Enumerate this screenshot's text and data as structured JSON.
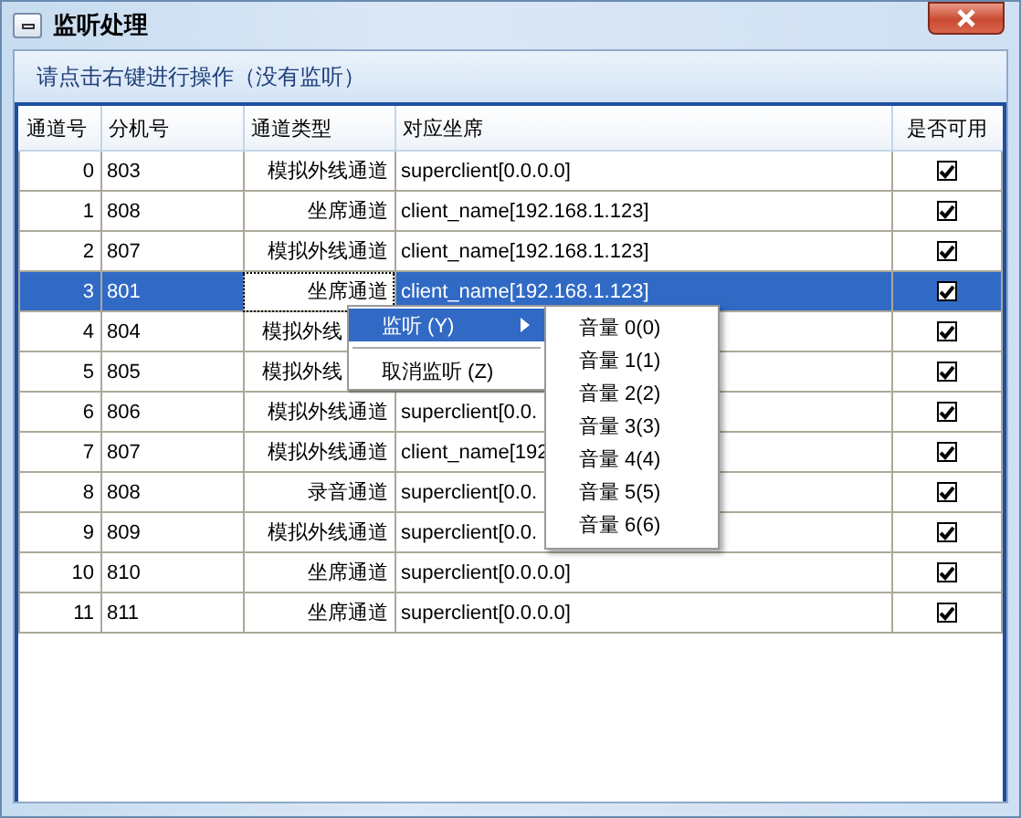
{
  "window": {
    "title": "监听处理"
  },
  "hint": "请点击右键进行操作（没有监听）",
  "table": {
    "columns": [
      "通道号",
      "分机号",
      "通道类型",
      "对应坐席",
      "是否可用"
    ],
    "rows": [
      {
        "channel": "0",
        "extension": "803",
        "type": "模拟外线通道",
        "seat": "superclient[0.0.0.0]",
        "enabled": true,
        "selected": false
      },
      {
        "channel": "1",
        "extension": "808",
        "type": "坐席通道",
        "seat": "client_name[192.168.1.123]",
        "enabled": true,
        "selected": false
      },
      {
        "channel": "2",
        "extension": "807",
        "type": "模拟外线通道",
        "seat": "client_name[192.168.1.123]",
        "enabled": true,
        "selected": false
      },
      {
        "channel": "3",
        "extension": "801",
        "type": "坐席通道",
        "seat": "client_name[192.168.1.123]",
        "enabled": true,
        "selected": true
      },
      {
        "channel": "4",
        "extension": "804",
        "type": "模拟外线",
        "type_clipped": true,
        "enabled": true,
        "selected": false
      },
      {
        "channel": "5",
        "extension": "805",
        "type": "模拟外线",
        "type_clipped": true,
        "enabled": true,
        "selected": false
      },
      {
        "channel": "6",
        "extension": "806",
        "type": "模拟外线通道",
        "seat": "superclient[0.0.",
        "enabled": true,
        "selected": false
      },
      {
        "channel": "7",
        "extension": "807",
        "type": "模拟外线通道",
        "seat": "client_name[192",
        "enabled": true,
        "selected": false
      },
      {
        "channel": "8",
        "extension": "808",
        "type": "录音通道",
        "seat": "superclient[0.0.",
        "enabled": true,
        "selected": false
      },
      {
        "channel": "9",
        "extension": "809",
        "type": "模拟外线通道",
        "seat": "superclient[0.0.",
        "enabled": true,
        "selected": false
      },
      {
        "channel": "10",
        "extension": "810",
        "type": "坐席通道",
        "seat": "superclient[0.0.0.0]",
        "enabled": true,
        "selected": false
      },
      {
        "channel": "11",
        "extension": "811",
        "type": "坐席通道",
        "seat": "superclient[0.0.0.0]",
        "enabled": true,
        "selected": false
      }
    ]
  },
  "context_menu": {
    "items": [
      {
        "kind": "item",
        "label": "监听",
        "shortcut": "(Y)",
        "submenu": true,
        "selected": true
      },
      {
        "kind": "separator"
      },
      {
        "kind": "item",
        "label": "取消监听",
        "shortcut": "(Z)",
        "submenu": false,
        "selected": false
      }
    ]
  },
  "submenu": {
    "items": [
      {
        "label": "音量",
        "number": "0",
        "shortcut": "(0)"
      },
      {
        "label": "音量",
        "number": "1",
        "shortcut": "(1)"
      },
      {
        "label": "音量",
        "number": "2",
        "shortcut": "(2)"
      },
      {
        "label": "音量",
        "number": "3",
        "shortcut": "(3)"
      },
      {
        "label": "音量",
        "number": "4",
        "shortcut": "(4)"
      },
      {
        "label": "音量",
        "number": "5",
        "shortcut": "(5)"
      },
      {
        "label": "音量",
        "number": "6",
        "shortcut": "(6)"
      }
    ]
  }
}
